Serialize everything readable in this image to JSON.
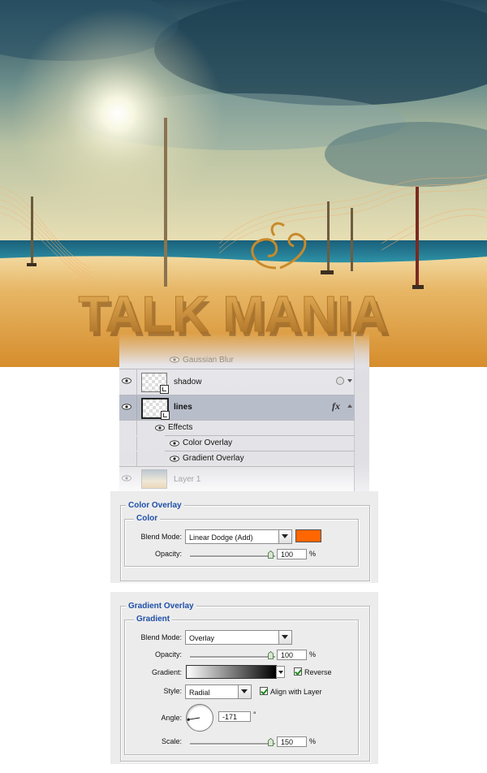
{
  "artwork": {
    "title_text": "TALK MANIA",
    "colors": {
      "sky_top": "#1f4a5e",
      "sky_glow": "#f6f1d8",
      "sea": "#1f7f9a",
      "sand": "#e0a54a",
      "text": "#c98a2a",
      "accent": "#ff6600"
    }
  },
  "layers_panel": {
    "rows": [
      {
        "name": "Gaussian Blur",
        "state": "faded"
      },
      {
        "name": "shadow",
        "state": "normal"
      },
      {
        "name": "lines",
        "state": "selected",
        "fx_label": "fx"
      },
      {
        "name": "Effects",
        "state": "effects-header"
      },
      {
        "name": "Color Overlay",
        "state": "effect"
      },
      {
        "name": "Gradient Overlay",
        "state": "effect"
      },
      {
        "name": "Layer 1",
        "state": "faded"
      }
    ]
  },
  "color_overlay": {
    "title": "Color Overlay",
    "group_title": "Color",
    "blend_mode_label": "Blend Mode:",
    "blend_mode_value": "Linear Dodge (Add)",
    "swatch_color": "#ff6600",
    "opacity_label": "Opacity:",
    "opacity_value": "100",
    "opacity_unit": "%",
    "opacity_level": 1.0
  },
  "gradient_overlay": {
    "title": "Gradient Overlay",
    "group_title": "Gradient",
    "blend_mode_label": "Blend Mode:",
    "blend_mode_value": "Overlay",
    "opacity_label": "Opacity:",
    "opacity_value": "100",
    "opacity_unit": "%",
    "opacity_level": 1.0,
    "gradient_label": "Gradient:",
    "reverse_label": "Reverse",
    "reverse_checked": true,
    "style_label": "Style:",
    "style_value": "Radial",
    "align_label": "Align with Layer",
    "align_checked": true,
    "angle_label": "Angle:",
    "angle_value": "-171",
    "angle_unit": "°",
    "scale_label": "Scale:",
    "scale_value": "150",
    "scale_unit": "%",
    "scale_level": 1.0
  }
}
